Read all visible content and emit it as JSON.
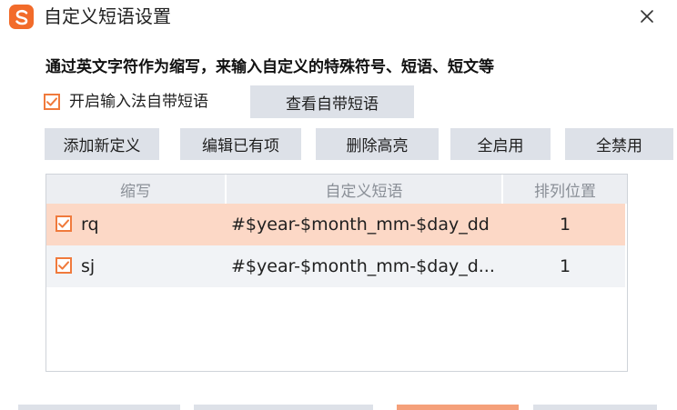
{
  "window": {
    "title": "自定义短语设置",
    "logo_icon": "sogou-s-logo-icon",
    "close_icon": "close-icon",
    "accent_color": "#f07a3c"
  },
  "description": "通过英文字符作为缩写，来输入自定义的特殊符号、短语、短文等",
  "enable_builtin": {
    "checked": true,
    "label": "开启输入法自带短语"
  },
  "view_builtin_button": "查看自带短语",
  "toolbar": {
    "add": "添加新定义",
    "edit": "编辑已有项",
    "delete_highlight": "删除高亮",
    "enable_all": "全启用",
    "disable_all": "全禁用"
  },
  "table": {
    "columns": [
      "缩写",
      "自定义短语",
      "排列位置"
    ],
    "rows": [
      {
        "checked": true,
        "abbr": "rq",
        "phrase": "#$year-$month_mm-$day_dd",
        "position": "1",
        "selected": true
      },
      {
        "checked": true,
        "abbr": "sj",
        "phrase": "#$year-$month_mm-$day_d...",
        "position": "1",
        "selected": false
      }
    ],
    "selected_row_color": "#fcd8c6"
  }
}
